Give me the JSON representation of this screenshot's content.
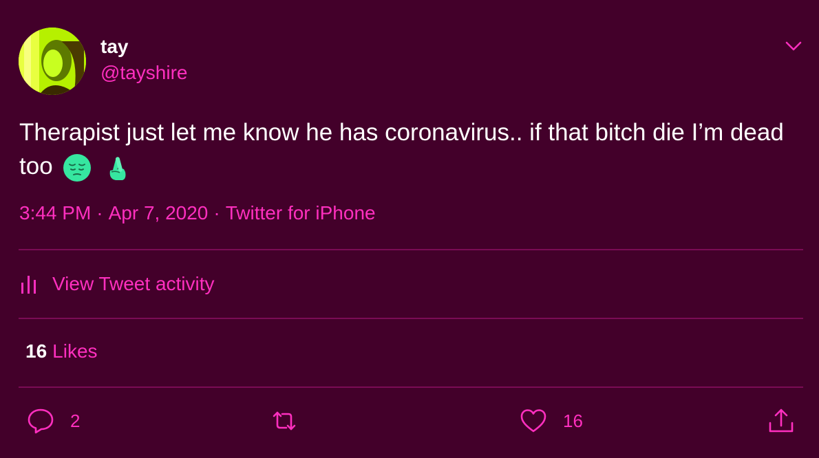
{
  "author": {
    "name": "tay",
    "handle": "@tayshire"
  },
  "tweet": {
    "text": "Therapist just let me know he has coronavirus.. if that bitch die I’m dead too",
    "emoji": [
      "pensive-face",
      "crossed-fingers"
    ]
  },
  "meta": {
    "time": "3:44 PM",
    "date": "Apr 7, 2020",
    "source": "Twitter for iPhone",
    "separator": "·"
  },
  "activity": {
    "label": "View Tweet activity"
  },
  "likes": {
    "count": "16",
    "label": "Likes"
  },
  "actions": {
    "reply_count": "2",
    "like_count": "16"
  },
  "colors": {
    "background": "#43002a",
    "accent": "#ff2fbf",
    "text": "#ffffff",
    "emoji": "#36e6a0"
  }
}
